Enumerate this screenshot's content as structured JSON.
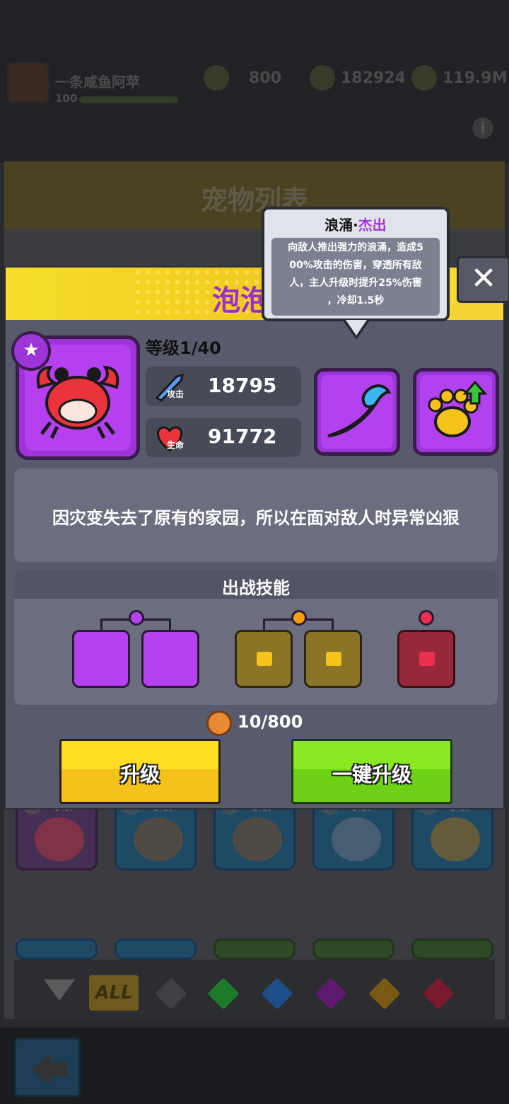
{
  "hud": {
    "player_name": "一条咸鱼阿苹",
    "player_level": "100",
    "gems": "800",
    "power": "182924",
    "gold": "119.9M"
  },
  "list": {
    "title": "宠物列表",
    "card_level": "等级1"
  },
  "filter": {
    "all_label": "ALL",
    "gem_colors": [
      "#3f3f44",
      "#1c7a2a",
      "#1e4e8a",
      "#5e1a6e",
      "#7a5a12",
      "#7a1a2e"
    ]
  },
  "modal": {
    "pet_name": "泡泡",
    "level": "等级1/40",
    "attack_label": "攻击",
    "attack_value": "18795",
    "hp_label": "生命",
    "hp_value": "91772",
    "description": "因灾变失去了原有的家园，所以在面对敌人时异常凶狠",
    "battle_skills_title": "出战技能",
    "cost": "10/800",
    "upgrade_label": "升级",
    "one_click_upgrade_label": "一键升级",
    "close_label": "✕"
  },
  "tooltip": {
    "skill_name": "浪涌·",
    "quality": "杰出",
    "line1": "向敌人推出强力的浪涌，造成5",
    "line2": "00%攻击的伤害，穿透所有敌",
    "line3": "人，主人升级时提升25%伤害",
    "line4": "，冷却1.5秒"
  },
  "colors": {
    "epic_purple": "#b242ee",
    "gold_yellow": "#f4c21a",
    "green": "#6fd116"
  }
}
